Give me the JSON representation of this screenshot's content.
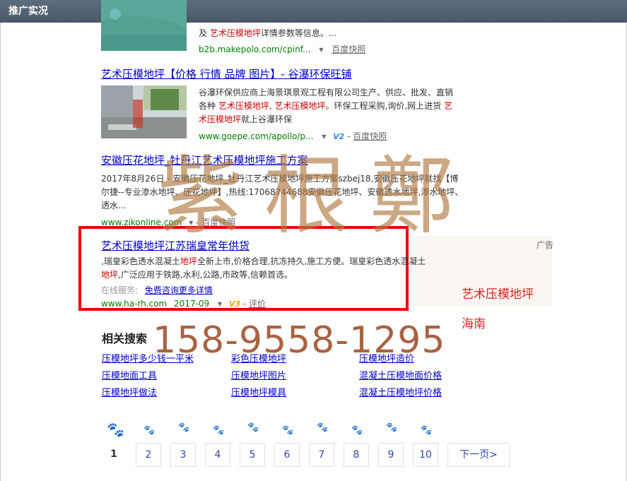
{
  "window": {
    "title": "推广实况"
  },
  "result1": {
    "snippet_line1_prefix": "",
    "snippet_line2": "及 ",
    "kw": "艺术压模地坪",
    "snippet_line2_tail": "详情参数等信息。...",
    "url": "b2b.makepolo.com/cpinf...",
    "cache": "百度快照"
  },
  "result2": {
    "title": "艺术压模地坪【价格 行情 品牌 图片】- 谷瀑环保旺铺",
    "line1": "谷瀑环保供应商上海景琪景观工程有限公司生产、供应、批发、直销",
    "line2_a": "各种 ",
    "line2_kw1": "艺术压模地坪",
    "line2_b": ", ",
    "line2_kw2": "艺术压模地坪",
    "line2_c": "。环保工程采购,询价,网上进货 ",
    "line2_kw3": "艺",
    "line3_kw": "术压模地坪",
    "line3_tail": "就上谷瀑环保",
    "url": "www.goepe.com/apollo/p...",
    "badge": "V2",
    "cache": "百度快照"
  },
  "result3": {
    "title": "安徽压花地坪_牡丹江艺术压模地坪施工方案",
    "line1": "2017年8月26日 - 安徽压花地坪_牡丹江艺术压模地坪施工方案szbej18,安徽压花地坪就找【博",
    "line2": "尔捷--专业渗水地坪、压花地坪】,热线:17068744688安徽压花地坪、安徽透水地坪,渗水地坪、",
    "line3": "透水...",
    "url": "www.zikonline.com",
    "cache": "百度快照"
  },
  "ad": {
    "title": "艺术压模地坪江苏瑞皇常年供货",
    "label": "广告",
    "line1_a": ",瑞皇彩色透水混凝土",
    "line1_kw": "地坪",
    "line1_b": "全新上市,价格合理,抗冻持久,施工方便。瑞皇彩色透水混凝土",
    "line2_kw": "地坪",
    "line2_b": ",广泛应用于铁路,水利,公路,市政等,信赖首选。",
    "service_label": "在线服务:",
    "service_link": "免费咨询更多详情",
    "url": "www.ha-rh.com",
    "date": "2017-09",
    "badge": "V3",
    "review": "评价"
  },
  "related": {
    "title": "相关搜索",
    "links": [
      [
        "压模地坪多少钱一平米",
        "彩色压模地坪",
        "压模地坪造价"
      ],
      [
        "压模地面工具",
        "压模地坪图片",
        "混凝土压模地面价格"
      ],
      [
        "压模地坪做法",
        "压模地坪模具",
        "混凝土压模地坪价格"
      ]
    ]
  },
  "pagination": {
    "pages": [
      "1",
      "2",
      "3",
      "4",
      "5",
      "6",
      "7",
      "8",
      "9",
      "10"
    ],
    "next": "下一页>"
  },
  "overlay": {
    "phone": "158-9558-1295",
    "red_label1": "艺术压模地坪",
    "red_label2": "海南",
    "seal_text": "紫根鄭"
  },
  "colors": {
    "link": "#0000cc",
    "keyword": "#cc0000",
    "url": "#008000",
    "ad_border": "#ee0000",
    "overlay_brown": "#b07a42"
  }
}
